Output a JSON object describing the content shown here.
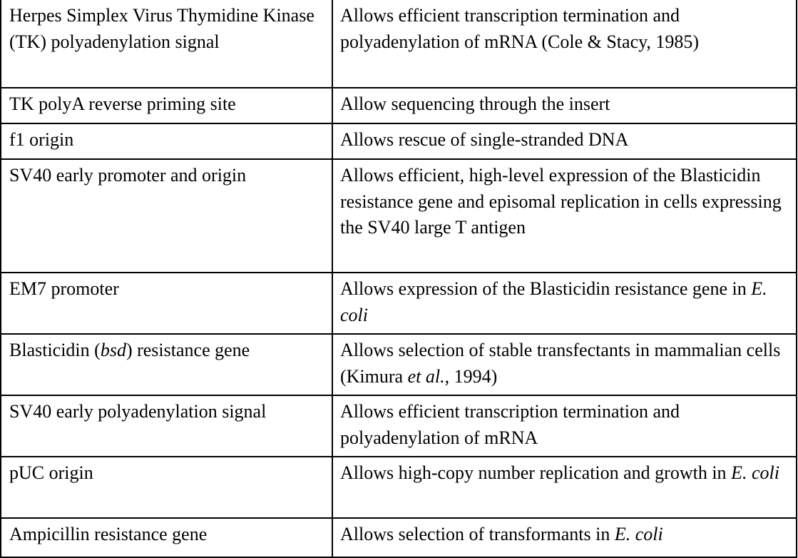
{
  "rows": [
    {
      "feature": [
        {
          "t": "Herpes Simplex Virus Thymidine Kinase (TK) polyadenylation signal"
        }
      ],
      "benefit": [
        {
          "t": "Allows efficient transcription termination and polyadenylation of mRNA (Cole & Stacy, 1985)"
        }
      ]
    },
    {
      "feature": [
        {
          "t": "TK polyA reverse priming site"
        }
      ],
      "benefit": [
        {
          "t": "Allow sequencing through the insert"
        }
      ]
    },
    {
      "feature": [
        {
          "t": "f1 origin"
        }
      ],
      "benefit": [
        {
          "t": "Allows rescue of single-stranded DNA"
        }
      ]
    },
    {
      "feature": [
        {
          "t": "SV40 early promoter and origin"
        }
      ],
      "benefit": [
        {
          "t": "Allows efficient, high-level expression of the Blasticidin resistance gene and episomal replication in cells expressing the SV40 large T antigen"
        }
      ]
    },
    {
      "feature": [
        {
          "t": "EM7 promoter"
        }
      ],
      "benefit": [
        {
          "t": "Allows expression of the Blasticidin resistance gene in "
        },
        {
          "t": "E. coli",
          "i": true
        }
      ]
    },
    {
      "feature": [
        {
          "t": "Blasticidin ("
        },
        {
          "t": "bsd",
          "i": true
        },
        {
          "t": ") resistance gene"
        }
      ],
      "benefit": [
        {
          "t": "Allows selection of stable transfectants in mammalian cells (Kimura "
        },
        {
          "t": "et al.",
          "i": true
        },
        {
          "t": ", 1994)"
        }
      ]
    },
    {
      "feature": [
        {
          "t": "SV40 early polyadenylation signal"
        }
      ],
      "benefit": [
        {
          "t": "Allows efficient transcription termination and polyadenylation of mRNA"
        }
      ]
    },
    {
      "feature": [
        {
          "t": "pUC origin"
        }
      ],
      "benefit": [
        {
          "t": "Allows high-copy number replication and growth in "
        },
        {
          "t": "E. coli",
          "i": true
        }
      ]
    },
    {
      "feature": [
        {
          "t": "Ampicillin resistance gene"
        }
      ],
      "benefit": [
        {
          "t": "Allows selection of transformants in "
        },
        {
          "t": "E. coli",
          "i": true
        }
      ]
    }
  ]
}
